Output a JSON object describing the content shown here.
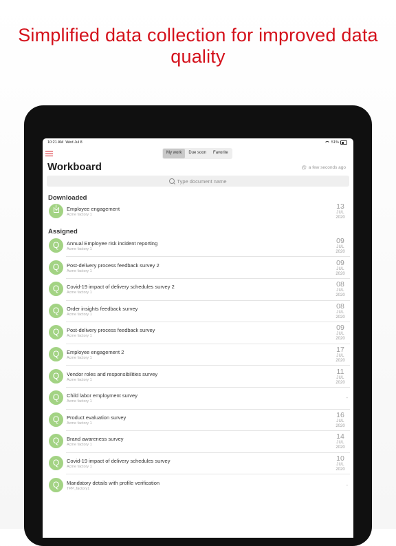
{
  "headline": "Simplified data collection for improved data quality",
  "status": {
    "time": "10:21 AM",
    "date": "Wed Jul 8",
    "battery": "51%"
  },
  "tabs": [
    {
      "label": "My work",
      "active": true
    },
    {
      "label": "Due soon",
      "active": false
    },
    {
      "label": "Favorite",
      "active": false
    }
  ],
  "page": {
    "title": "Workboard",
    "sync_text": "a few seconds ago"
  },
  "search": {
    "placeholder": "Type document name"
  },
  "downloaded": {
    "title": "Downloaded",
    "items": [
      {
        "name": "Employee engagement",
        "sub": "Acme factory 1",
        "day": "13",
        "month": "JUL",
        "year": "2020"
      }
    ]
  },
  "assigned": {
    "title": "Assigned",
    "items": [
      {
        "initial": "Q",
        "name": "Annual Employee risk incident reporting",
        "sub": "Acme factory 1",
        "day": "09",
        "month": "JUL",
        "year": "2020"
      },
      {
        "initial": "Q",
        "name": "Post-delivery process feedback survey 2",
        "sub": "Acme factory 1",
        "day": "09",
        "month": "JUL",
        "year": "2020"
      },
      {
        "initial": "Q",
        "name": "Covid-19 impact of delivery schedules survey 2",
        "sub": "Acme factory 1",
        "day": "08",
        "month": "JUL",
        "year": "2020"
      },
      {
        "initial": "Q",
        "name": "Order insights feedback survey",
        "sub": "Acme factory 1",
        "day": "08",
        "month": "JUL",
        "year": "2020"
      },
      {
        "initial": "Q",
        "name": "Post-delivery process feedback survey",
        "sub": "Acme factory 1",
        "day": "09",
        "month": "JUL",
        "year": "2020"
      },
      {
        "initial": "Q",
        "name": "Employee engagement 2",
        "sub": "Acme factory 1",
        "day": "17",
        "month": "JUL",
        "year": "2020"
      },
      {
        "initial": "Q",
        "name": "Vendor roles and responsibilities survey",
        "sub": "Acme factory 1",
        "day": "11",
        "month": "JUL",
        "year": "2020"
      },
      {
        "initial": "Q",
        "name": "Child labor employment survey",
        "sub": "Acme factory 1",
        "nodate": "-"
      },
      {
        "initial": "Q",
        "name": "Product evaluation survey",
        "sub": "Acme factory 1",
        "day": "16",
        "month": "JUL",
        "year": "2020"
      },
      {
        "initial": "Q",
        "name": "Brand awareness survey",
        "sub": "Acme factory 1",
        "day": "14",
        "month": "JUL",
        "year": "2020"
      },
      {
        "initial": "Q",
        "name": "Covid-19 impact of delivery schedules survey",
        "sub": "Acme factory 1",
        "day": "10",
        "month": "JUL",
        "year": "2020"
      },
      {
        "initial": "Q",
        "name": "Mandatory details with profile verification",
        "sub": "TPP_factory1",
        "nodate": "-"
      }
    ]
  },
  "colors": {
    "accent": "#d4111b",
    "avatar": "#a3d384"
  },
  "icons": {
    "menu": "hamburger-icon",
    "search": "search-icon",
    "sync": "sync-icon",
    "download": "download-icon"
  }
}
